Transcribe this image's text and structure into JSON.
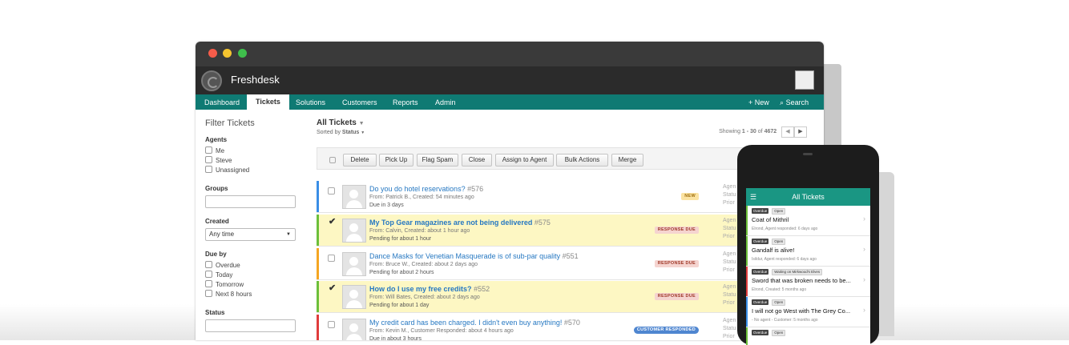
{
  "app": {
    "name": "Freshdesk"
  },
  "nav": {
    "tabs": [
      "Dashboard",
      "Tickets",
      "Solutions",
      "Customers",
      "Reports",
      "Admin"
    ],
    "active": "Tickets",
    "new_label": "New",
    "search_label": "Search"
  },
  "sidebar": {
    "title": "Filter Tickets",
    "agents": {
      "heading": "Agents",
      "options": [
        "Me",
        "Steve",
        "Unassigned"
      ]
    },
    "groups": {
      "heading": "Groups"
    },
    "created": {
      "heading": "Created",
      "value": "Any time"
    },
    "due_by": {
      "heading": "Due by",
      "options": [
        "Overdue",
        "Today",
        "Tomorrow",
        "Next 8 hours"
      ]
    },
    "status": {
      "heading": "Status"
    }
  },
  "main": {
    "title": "All Tickets",
    "sorted_by_label": "Sorted by",
    "sorted_by_value": "Status",
    "paging_prefix": "Showing",
    "paging_range": "1 - 30",
    "paging_of": "of",
    "paging_total": "4672"
  },
  "toolbar": {
    "buttons": [
      "Delete",
      "Pick Up",
      "Flag Spam",
      "Close",
      "Assign to Agent",
      "Bulk Actions",
      "Merge"
    ]
  },
  "tickets": [
    {
      "subject": "Do you do hotel reservations?",
      "number": "#576",
      "from": "From: Patrick B., Created: 54 minutes ago",
      "due": "Due in 3 days",
      "badge": "NEW",
      "checked": false,
      "highlight": false,
      "bar_color": "#3a8ee6",
      "side": [
        "Agen",
        "Statu",
        "Prior"
      ]
    },
    {
      "subject": "My Top Gear magazines are not being delivered",
      "number": "#575",
      "from": "From: Calvin, Created: about 1 hour ago",
      "due": "Pending for about 1 hour",
      "badge": "RESPONSE DUE",
      "checked": true,
      "highlight": true,
      "bar_color": "#6cbf3a",
      "side": [
        "Agen",
        "Statu",
        "Prior"
      ]
    },
    {
      "subject": "Dance Masks for Venetian Masquerade is of sub-par quality",
      "number": "#551",
      "from": "From: Bruce W., Created: about 2 days ago",
      "due": "Pending for about 2 hours",
      "badge": "RESPONSE DUE",
      "checked": false,
      "highlight": false,
      "bar_color": "#f5a623",
      "side": [
        "Agen",
        "Statu",
        "Prior"
      ]
    },
    {
      "subject": "How do I use my free credits?",
      "number": "#552",
      "from": "From: Will Bates, Created: about 2 days ago",
      "due": "Pending for about 1 day",
      "badge": "RESPONSE DUE",
      "checked": true,
      "highlight": true,
      "bar_color": "#6cbf3a",
      "side": [
        "Agen",
        "Statu",
        "Prior"
      ]
    },
    {
      "subject": "My credit card has been charged. I didn't even buy anything!",
      "number": "#570",
      "from": "From: Kevin M., Customer Responded: about 4 hours ago",
      "due": "Due in about 3 hours",
      "badge": "CUSTOMER RESPONDED",
      "checked": false,
      "highlight": false,
      "bar_color": "#e03c3c",
      "side": [
        "Agen",
        "Statu",
        "Prior"
      ]
    }
  ],
  "phone": {
    "title": "All Tickets",
    "items": [
      {
        "tags": [
          "Overdue",
          "Open"
        ],
        "title": "Coat of Mithril",
        "sub": "Elrond, Agent responded: 6 days ago",
        "bar_color": "#6cbf3a"
      },
      {
        "tags": [
          "Overdue",
          "Open"
        ],
        "title": "Gandalf is alive!",
        "sub": "Isildur, Agent responded: 6 days ago",
        "bar_color": "#6cbf3a"
      },
      {
        "tags": [
          "Overdue",
          "Waiting on Mirkwood's Elves"
        ],
        "title": "Sword that was broken needs to be...",
        "sub": "Elrond, Created: 5 months ago",
        "bar_color": "#e03c3c"
      },
      {
        "tags": [
          "Overdue",
          "Open"
        ],
        "title": "I will not go West with The Grey Co...",
        "sub": "- No agent - Customer: 5 months ago",
        "bar_color": "#3a8ee6"
      },
      {
        "tags": [
          "Overdue",
          "Open"
        ],
        "title": "",
        "sub": "",
        "bar_color": "#6cbf3a"
      }
    ]
  },
  "colors": {
    "nav_teal": "#0f7a73",
    "phone_header": "#1a9683",
    "link_blue": "#2678c2",
    "highlight_row": "#fdf7c3"
  }
}
